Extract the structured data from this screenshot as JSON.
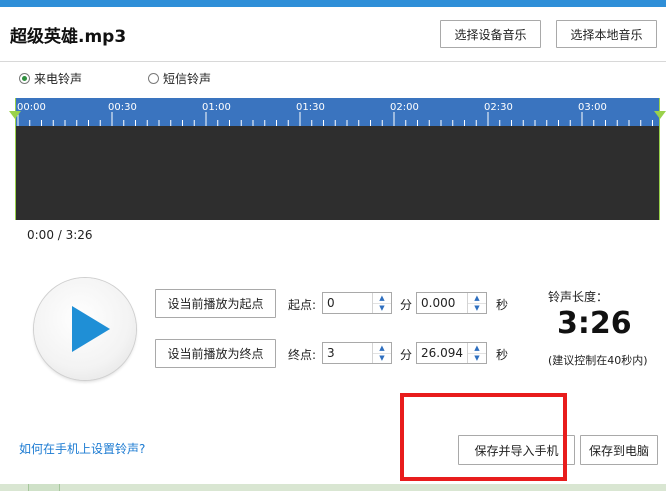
{
  "title": "超级英雄.mp3",
  "buttons": {
    "device_music": "选择设备音乐",
    "local_music": "选择本地音乐",
    "set_start": "设当前播放为起点",
    "set_end": "设当前播放为终点",
    "save_phone": "保存并导入手机",
    "save_pc": "保存到电脑"
  },
  "radios": {
    "ringtone": "来电铃声",
    "sms": "短信铃声",
    "selected": "ringtone"
  },
  "timeline": {
    "ticks": [
      "00:00",
      "00:30",
      "01:00",
      "01:30",
      "02:00",
      "02:30",
      "03:00"
    ]
  },
  "time_readout": "0:00 / 3:26",
  "start": {
    "label": "起点:",
    "min": "0",
    "min_unit": "分",
    "sec": "0.000",
    "sec_unit": "秒"
  },
  "end": {
    "label": "终点:",
    "min": "3",
    "min_unit": "分",
    "sec": "26.094",
    "sec_unit": "秒"
  },
  "ring_length": {
    "label": "铃声长度：",
    "value": "3:26",
    "hint": "(建议控制在40秒内)"
  },
  "help_link": "如何在手机上设置铃声?",
  "colors": {
    "accent": "#2f8fd8",
    "ruler": "#3a74bf",
    "waveform_bg": "#2e2e2e",
    "play_icon": "#1f8fd6",
    "highlight": "#e81c1c"
  },
  "icons": {
    "play": "play-icon",
    "spin_up": "up-arrow-icon",
    "spin_down": "down-arrow-icon"
  }
}
